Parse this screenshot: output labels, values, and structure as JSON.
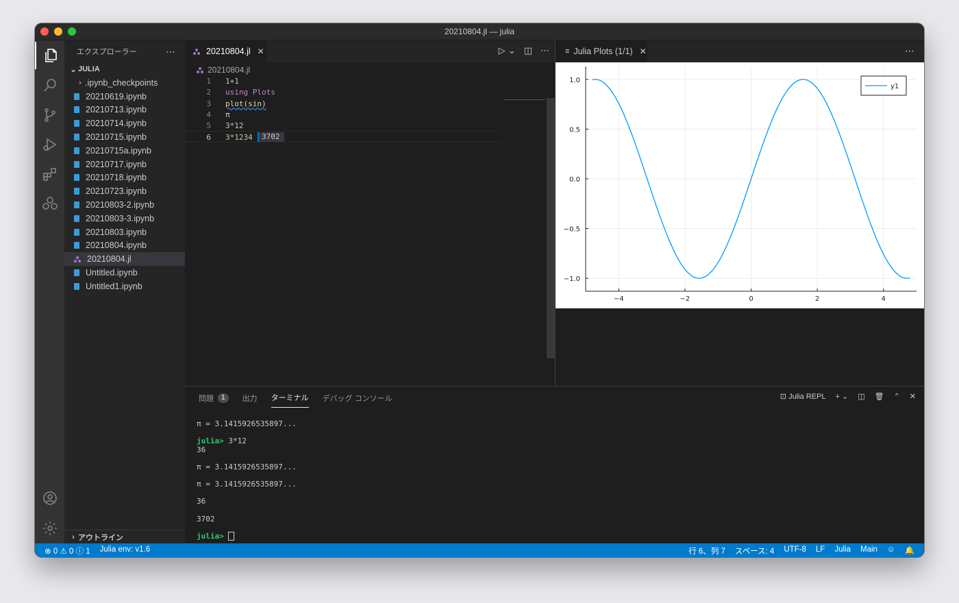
{
  "window": {
    "title": "20210804.jl — julia"
  },
  "sidebar": {
    "title": "エクスプローラー",
    "folder": "JULIA",
    "subfolder": ".ipynb_checkpoints",
    "files": [
      {
        "name": "20210619.ipynb",
        "type": "notebook"
      },
      {
        "name": "20210713.ipynb",
        "type": "notebook"
      },
      {
        "name": "20210714.ipynb",
        "type": "notebook"
      },
      {
        "name": "20210715.ipynb",
        "type": "notebook"
      },
      {
        "name": "20210715a.ipynb",
        "type": "notebook"
      },
      {
        "name": "20210717.ipynb",
        "type": "notebook"
      },
      {
        "name": "20210718.ipynb",
        "type": "notebook"
      },
      {
        "name": "20210723.ipynb",
        "type": "notebook"
      },
      {
        "name": "20210803-2.ipynb",
        "type": "notebook"
      },
      {
        "name": "20210803-3.ipynb",
        "type": "notebook"
      },
      {
        "name": "20210803.ipynb",
        "type": "notebook"
      },
      {
        "name": "20210804.ipynb",
        "type": "notebook"
      },
      {
        "name": "20210804.jl",
        "type": "julia",
        "selected": true
      },
      {
        "name": "Untitled.ipynb",
        "type": "notebook"
      },
      {
        "name": "Untitled1.ipynb",
        "type": "notebook"
      }
    ],
    "outline": "アウトライン"
  },
  "editor": {
    "tab": "20210804.jl",
    "breadcrumb": "20210804.jl",
    "lines": [
      "1+1",
      "using Plots",
      "plot(sin)",
      "π",
      "3*12",
      "3*1234"
    ],
    "line_numbers": [
      "1",
      "2",
      "3",
      "4",
      "5",
      "6"
    ],
    "inline_result": "3702"
  },
  "plot_pane": {
    "tab": "Julia Plots (1/1)"
  },
  "chart_data": {
    "type": "line",
    "function": "sin",
    "xlim": [
      -5,
      5
    ],
    "ylim": [
      -1.0,
      1.0
    ],
    "xticks": [
      "−4",
      "−2",
      "0",
      "2",
      "4"
    ],
    "xtick_values": [
      -4,
      -2,
      0,
      2,
      4
    ],
    "yticks": [
      "1.0",
      "0.5",
      "0.0",
      "−0.5",
      "−1.0"
    ],
    "ytick_values": [
      1.0,
      0.5,
      0.0,
      -0.5,
      -1.0
    ],
    "series": [
      {
        "name": "y1",
        "color": "#009af9"
      }
    ],
    "legend": "top-right",
    "grid": true
  },
  "panel": {
    "tabs": [
      {
        "label": "問題",
        "badge": "1"
      },
      {
        "label": "出力"
      },
      {
        "label": "ターミナル",
        "active": true
      },
      {
        "label": "デバッグ コンソール"
      }
    ],
    "terminal_name": "Julia REPL",
    "terminal_lines": [
      {
        "kind": "out",
        "text": "π = 3.1415926535897..."
      },
      {
        "kind": "blank",
        "text": ""
      },
      {
        "kind": "prompt",
        "prompt": "julia>",
        "text": " 3*12"
      },
      {
        "kind": "out",
        "text": "36"
      },
      {
        "kind": "blank",
        "text": ""
      },
      {
        "kind": "out",
        "text": "π = 3.1415926535897..."
      },
      {
        "kind": "blank",
        "text": ""
      },
      {
        "kind": "out",
        "text": "π = 3.1415926535897..."
      },
      {
        "kind": "blank",
        "text": ""
      },
      {
        "kind": "out",
        "text": "36"
      },
      {
        "kind": "blank",
        "text": ""
      },
      {
        "kind": "out",
        "text": "3702"
      },
      {
        "kind": "blank",
        "text": ""
      },
      {
        "kind": "prompt",
        "prompt": "julia>",
        "text": " ",
        "cursor": true
      }
    ]
  },
  "status": {
    "problems": "⊗ 0 ⚠ 0 ⓘ 1",
    "env": "Julia env: v1.6",
    "position": "行 6、列 7",
    "spaces": "スペース: 4",
    "encoding": "UTF-8",
    "eol": "LF",
    "language": "Julia",
    "module": "Main"
  },
  "colors": {
    "accent": "#007acc",
    "plot_line": "#009af9"
  }
}
